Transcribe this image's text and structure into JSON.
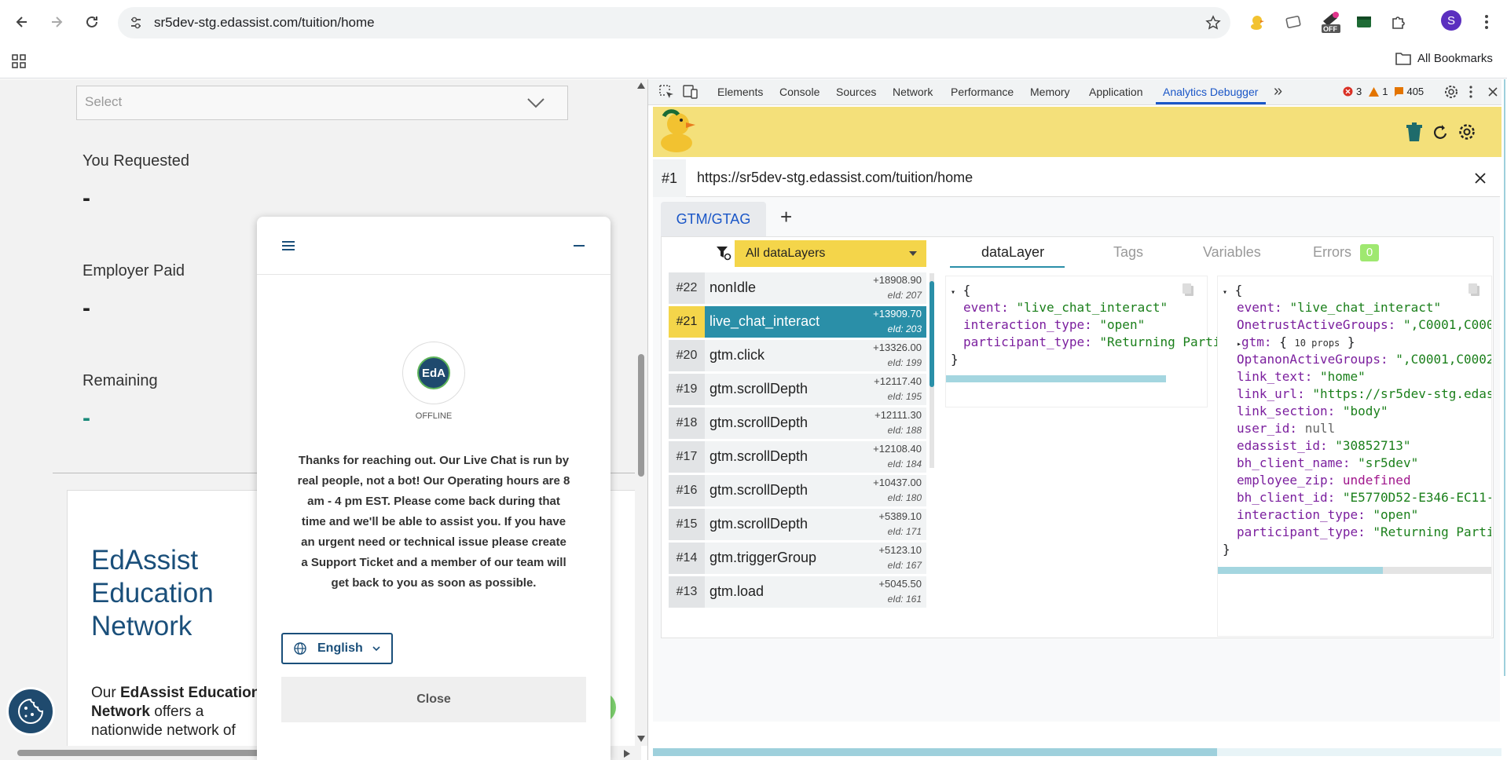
{
  "browser": {
    "url": "sr5dev-stg.edassist.com/tuition/home",
    "bookmarks_label": "All Bookmarks",
    "profile_initial": "S",
    "ext_badge": "OFF"
  },
  "page": {
    "select_placeholder": "Select",
    "you_requested_label": "You Requested",
    "you_requested_value": "-",
    "employer_paid_label": "Employer Paid",
    "employer_paid_value": "-",
    "remaining_label": "Remaining",
    "remaining_value": "-",
    "card_title_1": "EdAssist",
    "card_title_2": "Education",
    "card_title_3": "Network",
    "card_body_pre": "Our ",
    "card_body_bold": "EdAssist Education Network",
    "card_body_post": " offers a nationwide network of"
  },
  "chat": {
    "status": "OFFLINE",
    "avatar_text": "EdA",
    "message": "Thanks for reaching out. Our Live Chat is run by real people, not a bot! Our Operating hours are 8 am - 4 pm EST. Please come back during that time and we'll be able to assist you. If you have an urgent need or technical issue please create a Support Ticket and a member of our team will get back to you as soon as possible.",
    "language": "English",
    "close_label": "Close"
  },
  "devtools": {
    "tabs": [
      "Elements",
      "Console",
      "Sources",
      "Network",
      "Performance",
      "Memory",
      "Application",
      "Analytics Debugger"
    ],
    "active_tab": "Analytics Debugger",
    "errors": "3",
    "warnings": "1",
    "issues": "405"
  },
  "debugger": {
    "page_num": "#1",
    "page_url": "https://sr5dev-stg.edassist.com/tuition/home",
    "tool_tab": "GTM/GTAG",
    "filter_label": "All dataLayers",
    "sub_tabs": [
      "dataLayer",
      "Tags",
      "Variables",
      "Errors"
    ],
    "errors_count": "0",
    "events": [
      {
        "num": "#22",
        "name": "nonIdle",
        "time": "+18908.90",
        "eid": "eId: 207"
      },
      {
        "num": "#21",
        "name": "live_chat_interact",
        "time": "+13909.70",
        "eid": "eId: 203"
      },
      {
        "num": "#20",
        "name": "gtm.click",
        "time": "+13326.00",
        "eid": "eId: 199"
      },
      {
        "num": "#19",
        "name": "gtm.scrollDepth",
        "time": "+12117.40",
        "eid": "eId: 195"
      },
      {
        "num": "#18",
        "name": "gtm.scrollDepth",
        "time": "+12111.30",
        "eid": "eId: 188"
      },
      {
        "num": "#17",
        "name": "gtm.scrollDepth",
        "time": "+12108.40",
        "eid": "eId: 184"
      },
      {
        "num": "#16",
        "name": "gtm.scrollDepth",
        "time": "+10437.00",
        "eid": "eId: 180"
      },
      {
        "num": "#15",
        "name": "gtm.scrollDepth",
        "time": "+5389.10",
        "eid": "eId: 171"
      },
      {
        "num": "#14",
        "name": "gtm.triggerGroup",
        "time": "+5123.10",
        "eid": "eId: 167"
      },
      {
        "num": "#13",
        "name": "gtm.load",
        "time": "+5045.50",
        "eid": "eId: 161"
      }
    ],
    "push": {
      "event_key": "event:",
      "event_val": "\"live_chat_interact\"",
      "it_key": "interaction_type:",
      "it_val": "\"open\"",
      "pt_key": "participant_type:",
      "pt_val": "\"Returning Parti"
    },
    "state": {
      "event": "\"live_chat_interact\"",
      "onetrust": "\",C0001,C000",
      "gtm_props": "10 props",
      "optanon": "\",C0001,C0002",
      "link_text": "\"home\"",
      "link_url": "\"https://sr5dev-stg.edas",
      "link_section": "\"body\"",
      "user_id": "null",
      "edassist_id": "\"30852713\"",
      "bh_client_name": "\"sr5dev\"",
      "employee_zip": "undefined",
      "bh_client_id": "\"E5770D52-E346-EC11-",
      "interaction_type": "\"open\"",
      "participant_type": "\"Returning Parti"
    }
  }
}
